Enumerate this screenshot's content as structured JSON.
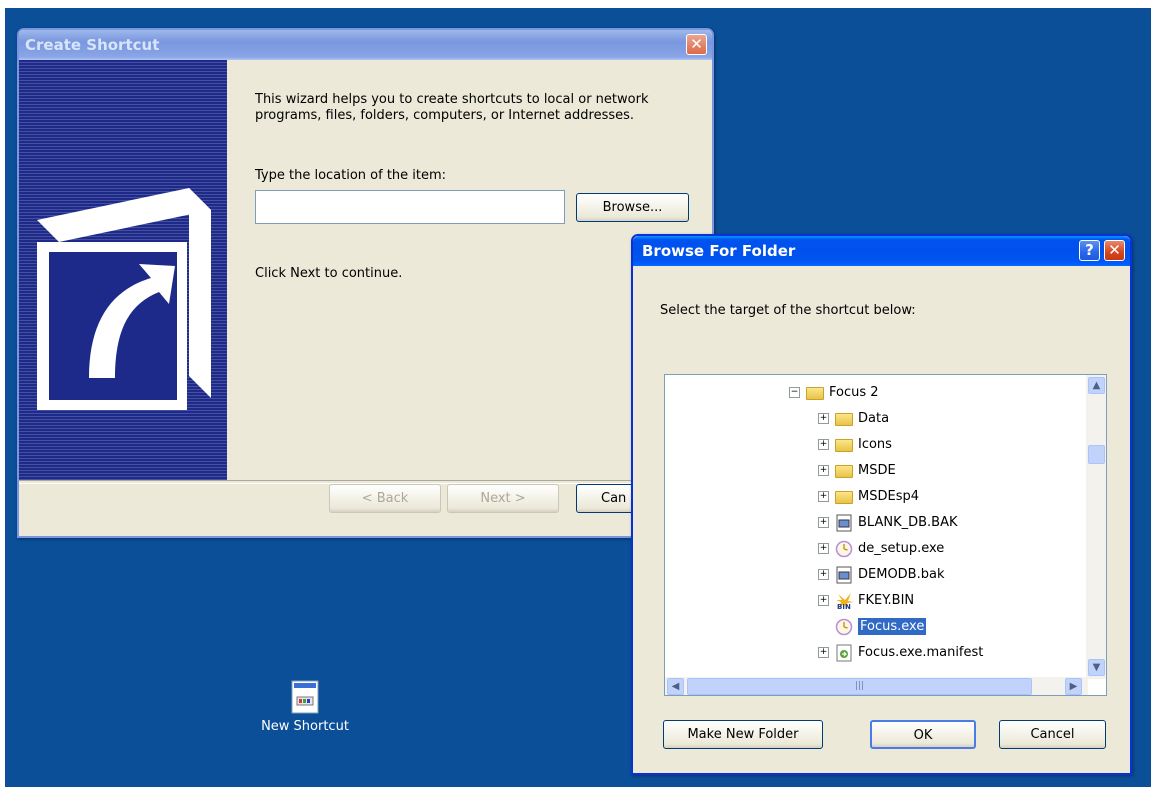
{
  "create_shortcut": {
    "title": "Create Shortcut",
    "intro": "This wizard helps you to create shortcuts to local or network programs, files, folders, computers, or Internet addresses.",
    "location_label": "Type the location of the item:",
    "location_value": "",
    "browse_label": "Browse...",
    "continue_text": "Click Next to continue.",
    "back_label": "< Back",
    "next_label": "Next >",
    "cancel_label": "Can"
  },
  "browse_folder": {
    "title": "Browse For Folder",
    "help_label": "?",
    "prompt": "Select the target of the shortcut below:",
    "tree": [
      {
        "label": "Focus 2",
        "expander": "−",
        "icon": "folder-icon"
      },
      {
        "label": "Data",
        "expander": "+",
        "icon": "folder-icon"
      },
      {
        "label": "Icons",
        "expander": "+",
        "icon": "folder-icon"
      },
      {
        "label": "MSDE",
        "expander": "+",
        "icon": "folder-icon"
      },
      {
        "label": "MSDEsp4",
        "expander": "+",
        "icon": "folder-icon"
      },
      {
        "label": "BLANK_DB.BAK",
        "expander": "+",
        "icon": "database-file-icon"
      },
      {
        "label": "de_setup.exe",
        "expander": "+",
        "icon": "clock-exe-icon"
      },
      {
        "label": "DEMODB.bak",
        "expander": "+",
        "icon": "database-file-icon"
      },
      {
        "label": "FKEY.BIN",
        "expander": "+",
        "icon": "bin-file-icon"
      },
      {
        "label": "Focus.exe",
        "expander": "",
        "icon": "clock-exe-icon",
        "selected": true
      },
      {
        "label": "Focus.exe.manifest",
        "expander": "+",
        "icon": "manifest-file-icon"
      }
    ],
    "make_folder_label": "Make New Folder",
    "ok_label": "OK",
    "cancel_label": "Cancel"
  },
  "desktop": {
    "shortcut_label": "New Shortcut"
  },
  "colors": {
    "desktop": "#0a4f98",
    "titlebar_active": "#0053ee",
    "selection": "#316ac5"
  }
}
